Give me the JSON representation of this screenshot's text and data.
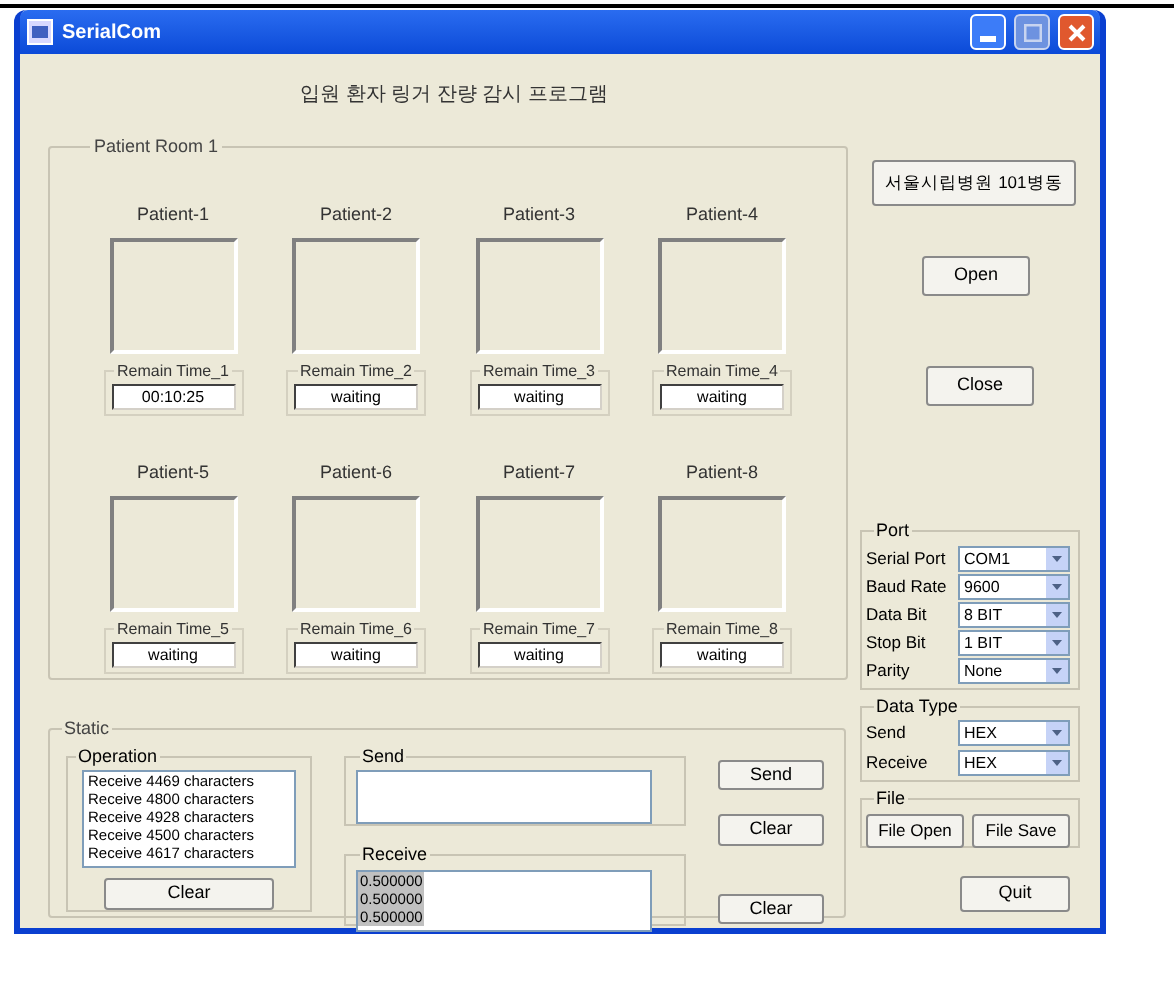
{
  "window": {
    "title": "SerialCom"
  },
  "heading": "입원 환자 링거 잔량 감시 프로그램",
  "room": {
    "title": "Patient Room 1",
    "patients": [
      {
        "name": "Patient-1",
        "remain_label": "Remain Time_1",
        "remain": "00:10:25"
      },
      {
        "name": "Patient-2",
        "remain_label": "Remain Time_2",
        "remain": "waiting"
      },
      {
        "name": "Patient-3",
        "remain_label": "Remain Time_3",
        "remain": "waiting"
      },
      {
        "name": "Patient-4",
        "remain_label": "Remain Time_4",
        "remain": "waiting"
      },
      {
        "name": "Patient-5",
        "remain_label": "Remain Time_5",
        "remain": "waiting"
      },
      {
        "name": "Patient-6",
        "remain_label": "Remain Time_6",
        "remain": "waiting"
      },
      {
        "name": "Patient-7",
        "remain_label": "Remain Time_7",
        "remain": "waiting"
      },
      {
        "name": "Patient-8",
        "remain_label": "Remain Time_8",
        "remain": "waiting"
      }
    ]
  },
  "side_buttons": [
    "서울시립병원 101병동",
    "Open",
    "Close"
  ],
  "port": {
    "title": "Port",
    "fields": [
      {
        "label": "Serial Port",
        "value": "COM1"
      },
      {
        "label": "Baud Rate",
        "value": "9600"
      },
      {
        "label": "Data Bit",
        "value": "8 BIT"
      },
      {
        "label": "Stop Bit",
        "value": "1 BIT"
      },
      {
        "label": "Parity",
        "value": "None"
      }
    ]
  },
  "data_type": {
    "title": "Data Type",
    "fields": [
      {
        "label": "Send",
        "value": "HEX"
      },
      {
        "label": "Receive",
        "value": "HEX"
      }
    ]
  },
  "file": {
    "title": "File",
    "buttons": [
      "File Open",
      "File Save"
    ]
  },
  "quit": "Quit",
  "static": {
    "title": "Static",
    "operation": {
      "title": "Operation",
      "items": [
        "Receive 4469 characters",
        "Receive 4800 characters",
        "Receive 4928 characters",
        "Receive 4500 characters",
        "Receive 4617 characters"
      ],
      "button": "Clear"
    },
    "send": {
      "title": "Send",
      "button": "Send",
      "clear": "Clear"
    },
    "receive": {
      "title": "Receive",
      "lines": [
        "0.500000",
        "0.500000",
        "0.500000"
      ],
      "button": "Clear"
    }
  }
}
